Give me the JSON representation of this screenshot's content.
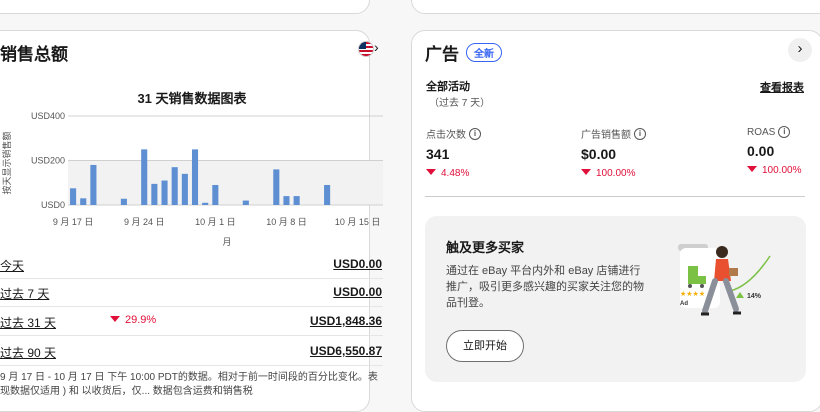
{
  "sales": {
    "title": "销售总额",
    "chart_title": "31 天销售数据图表",
    "rows": [
      {
        "label": "今天",
        "change": "",
        "value": "USD0.00"
      },
      {
        "label": "过去 7 天",
        "change": "",
        "value": "USD0.00"
      },
      {
        "label": "过去 31 天",
        "change": "29.9%",
        "value": "USD1,848.36"
      },
      {
        "label": "过去 90 天",
        "change": "",
        "value": "USD6,550.87"
      }
    ],
    "footnote": "9 月 17 日 - 10 月 17 日 下午 10:00 PDT的数据。相对于前一时间段的百分比变化。表现数据仅适用 ) 和 以收货后，仅... 数据包含运费和销售税"
  },
  "chart_data": {
    "type": "bar",
    "title": "31 天销售数据图表",
    "xlabel": "月",
    "ylabel": "按天显示销售额",
    "yticks": [
      "USD0",
      "USD200",
      "USD400"
    ],
    "ylim": [
      0,
      400
    ],
    "xticks": [
      "9 月 17 日",
      "9 月 24 日",
      "10 月 1 日",
      "10 月 8 日",
      "10 月 15 日"
    ],
    "values": [
      75,
      30,
      180,
      0,
      0,
      28,
      0,
      250,
      95,
      110,
      170,
      140,
      250,
      10,
      90,
      0,
      0,
      20,
      0,
      0,
      160,
      40,
      40,
      0,
      0,
      90,
      0,
      0,
      0,
      0,
      0
    ]
  },
  "ads": {
    "title": "广告",
    "badge": "全新",
    "activity_label": "全部活动",
    "activity_period": "（过去 7 天）",
    "report_link": "查看报表",
    "metrics": [
      {
        "label": "点击次数",
        "value": "341",
        "change": "4.48%"
      },
      {
        "label": "广告销售额",
        "value": "$0.00",
        "change": "100.00%"
      },
      {
        "label": "ROAS",
        "value": "0.00",
        "change": "100.00%"
      }
    ],
    "promo": {
      "title": "触及更多买家",
      "text": "通过在 eBay 平台内外和 eBay 店铺进行推广，吸引更多感兴趣的买家关注您的物品刊登。",
      "button": "立即开始",
      "ad_tag": "Ad",
      "growth": "14%"
    }
  },
  "colors": {
    "bar": "#5e8fd2",
    "down": "#e0103a",
    "accent": "#3665f3"
  }
}
